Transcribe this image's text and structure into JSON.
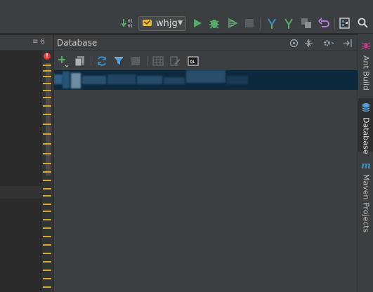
{
  "toolbar": {
    "run_config_name": "whjg",
    "icons": [
      "debug-mapping-icon",
      "run-config-icon",
      "run-icon",
      "debug-icon",
      "coverage-icon",
      "stop-icon",
      "vcs-update-icon",
      "vcs-commit-icon",
      "vcs-compare-icon",
      "vcs-revert-icon",
      "project-structure-icon",
      "search-icon"
    ]
  },
  "editor": {
    "header_menu": "≡ 6"
  },
  "database_panel": {
    "title": "Database",
    "header_icons": [
      "target-icon",
      "collapse-icon",
      "gear-icon",
      "hide-icon"
    ],
    "toolbar_icons": [
      "add-icon",
      "copy-icon",
      "refresh-icon",
      "sync-icon",
      "stop-icon",
      "table-icon",
      "edit-icon",
      "console-icon"
    ]
  },
  "right_stripe": {
    "items": [
      {
        "label": "Ant Build",
        "icon": "ant-icon",
        "active": false
      },
      {
        "label": "Database",
        "icon": "database-icon",
        "active": true
      },
      {
        "label": "Maven Projects",
        "icon": "maven-icon",
        "active": false
      }
    ]
  },
  "colors": {
    "panel_bg": "#3c3f41",
    "editor_bg": "#2b2b2b",
    "selection": "#0d293e",
    "run_green": "#59a869",
    "error_red": "#e03c3c",
    "mark_yellow": "#d4a72c"
  }
}
